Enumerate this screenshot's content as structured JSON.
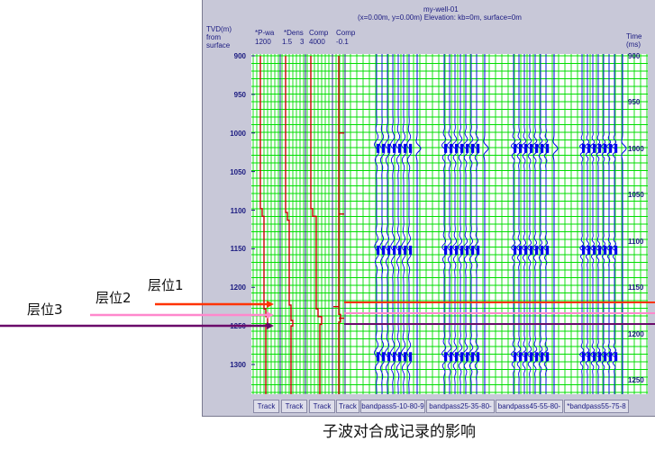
{
  "well_name": "my-well-01",
  "well_location": "(x=0.00m, y=0.00m) Elevation: kb=0m, surface=0m",
  "left_axis": {
    "label_line1": "TVD(m)",
    "label_line2": "from",
    "label_line3": "surface"
  },
  "right_axis": {
    "label_line1": "Time",
    "label_line2": "(ms)"
  },
  "track_headers": [
    {
      "name": "*P-wa",
      "scale": "1200"
    },
    {
      "name": "*Dens",
      "scale": "1.5    3"
    },
    {
      "name": "Comp",
      "scale": "4000"
    },
    {
      "name": "Comp",
      "scale": "-0.1"
    }
  ],
  "tvd_ticks": [
    {
      "value": 900,
      "label": "900"
    },
    {
      "value": 950,
      "label": "950"
    },
    {
      "value": 1000,
      "label": "1000"
    },
    {
      "value": 1050,
      "label": "1050"
    },
    {
      "value": 1100,
      "label": "1100"
    },
    {
      "value": 1150,
      "label": "1150"
    },
    {
      "value": 1200,
      "label": "1200"
    },
    {
      "value": 1250,
      "label": "1250"
    },
    {
      "value": 1300,
      "label": "1300"
    }
  ],
  "time_ticks": [
    {
      "value": 900,
      "label": "900"
    },
    {
      "value": 950,
      "label": "950"
    },
    {
      "value": 1000,
      "label": "1000"
    },
    {
      "value": 1050,
      "label": "1050"
    },
    {
      "value": 1100,
      "label": "1100"
    },
    {
      "value": 1150,
      "label": "1150"
    },
    {
      "value": 1200,
      "label": "1200"
    },
    {
      "value": 1250,
      "label": "1250"
    }
  ],
  "tabs": [
    {
      "label": "Track"
    },
    {
      "label": "Track"
    },
    {
      "label": "Track"
    },
    {
      "label": "Track"
    },
    {
      "label": "bandpass5-10-80-9"
    },
    {
      "label": "bandpass25-35-80-"
    },
    {
      "label": "bandpass45-55-80-"
    },
    {
      "label": "*bandpass55-75-8"
    }
  ],
  "horizons": [
    {
      "label": "层位1",
      "color": "#ff3300"
    },
    {
      "label": "层位2",
      "color": "#ff88cc"
    },
    {
      "label": "层位3",
      "color": "#6a0a6a"
    }
  ],
  "caption": "子波对合成记录的影响",
  "colors": {
    "grid": "#00dd00",
    "log_curve": "#cc0000",
    "wiggle": "#0000ee",
    "axis_text": "#1a1a80",
    "panel_bg": "#c8c8d8"
  }
}
